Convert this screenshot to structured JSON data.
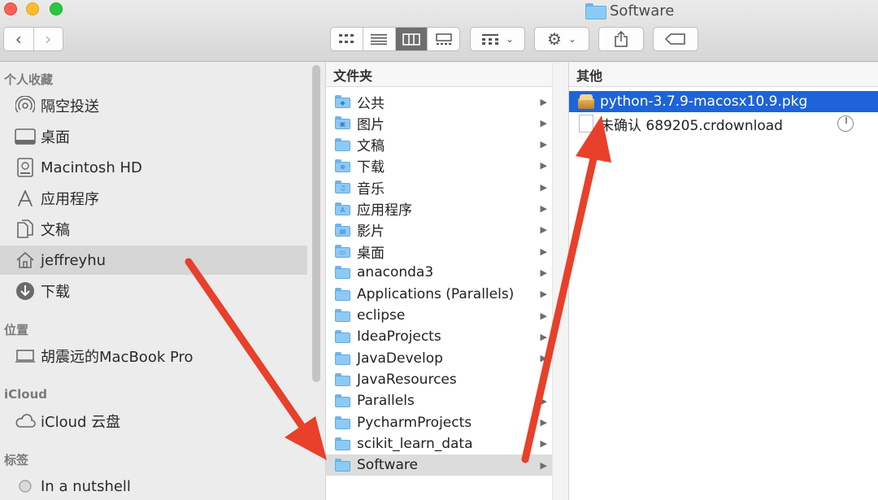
{
  "window": {
    "title": "Software"
  },
  "toolbar": {
    "back_icon": "chevron-left-icon",
    "forward_icon": "chevron-right-icon",
    "view_modes": [
      "icon-view",
      "list-view",
      "column-view",
      "gallery-view"
    ],
    "active_view": "column-view",
    "group_icon": "group-icon",
    "action_icon": "gear-icon",
    "share_icon": "share-icon",
    "tag_icon": "tag-icon"
  },
  "sidebar": {
    "favorites_header": "个人收藏",
    "favorites": [
      {
        "label": "隔空投送",
        "icon": "airdrop-icon"
      },
      {
        "label": "桌面",
        "icon": "desktop-icon"
      },
      {
        "label": "Macintosh HD",
        "icon": "hard-drive-icon"
      },
      {
        "label": "应用程序",
        "icon": "applications-icon"
      },
      {
        "label": "文稿",
        "icon": "documents-icon"
      },
      {
        "label": "jeffreyhu",
        "icon": "home-icon",
        "selected": true
      },
      {
        "label": "下载",
        "icon": "downloads-icon"
      }
    ],
    "locations_header": "位置",
    "locations": [
      {
        "label": "胡震远的MacBook Pro",
        "icon": "laptop-icon"
      }
    ],
    "icloud_header": "iCloud",
    "icloud": [
      {
        "label": "iCloud 云盘",
        "icon": "cloud-icon"
      }
    ],
    "tags_header": "标签",
    "tags": [
      {
        "label": "In a nutshell",
        "icon": "tag-circle-icon"
      }
    ]
  },
  "column1": {
    "header": "文件夹",
    "items": [
      {
        "label": "公共",
        "glyph": "◆"
      },
      {
        "label": "图片",
        "glyph": "▣"
      },
      {
        "label": "文稿",
        "glyph": ""
      },
      {
        "label": "下载",
        "glyph": "⊕"
      },
      {
        "label": "音乐",
        "glyph": "♫"
      },
      {
        "label": "应用程序",
        "glyph": "A"
      },
      {
        "label": "影片",
        "glyph": "▤"
      },
      {
        "label": "桌面",
        "glyph": "▭"
      },
      {
        "label": "anaconda3",
        "glyph": ""
      },
      {
        "label": "Applications (Parallels)",
        "glyph": ""
      },
      {
        "label": "eclipse",
        "glyph": ""
      },
      {
        "label": "IdeaProjects",
        "glyph": ""
      },
      {
        "label": "JavaDevelop",
        "glyph": ""
      },
      {
        "label": "JavaResources",
        "glyph": ""
      },
      {
        "label": "Parallels",
        "glyph": ""
      },
      {
        "label": "PycharmProjects",
        "glyph": ""
      },
      {
        "label": "scikit_learn_data",
        "glyph": ""
      },
      {
        "label": "Software",
        "glyph": "",
        "selected": true
      }
    ]
  },
  "column2": {
    "header": "其他",
    "items": [
      {
        "label": "python-3.7.9-macosx10.9.pkg",
        "icon": "package-icon",
        "selected": true
      },
      {
        "label": "未确认 689205.crdownload",
        "icon": "document-icon",
        "progress_icon": "download-progress-icon"
      }
    ]
  },
  "colors": {
    "selection_blue": "#1e64d8",
    "arrow_red": "#e8402a",
    "folder_blue": "#8ccaf6"
  }
}
